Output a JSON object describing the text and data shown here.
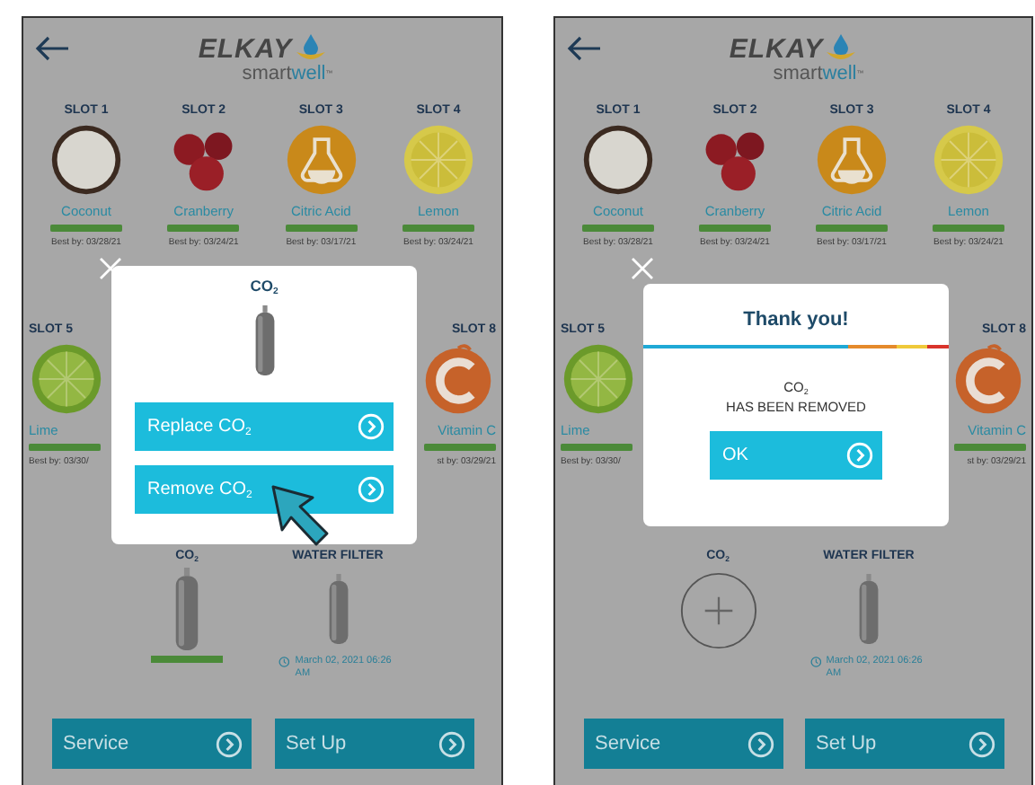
{
  "screens": [
    {
      "logo": {
        "brand": "ELKAY",
        "product": "smart",
        "product_accent": "well",
        "trademark": "™"
      },
      "slots": [
        {
          "label": "SLOT 1",
          "kind": "coconut",
          "name": "Coconut",
          "level": 1,
          "best_by": "Best by: 03/28/21"
        },
        {
          "label": "SLOT 2",
          "kind": "cranberry",
          "name": "Cranberry",
          "level": 1,
          "best_by": "Best by: 03/24/21"
        },
        {
          "label": "SLOT 3",
          "kind": "citric-acid",
          "name": "Citric Acid",
          "level": 1,
          "best_by": "Best by: 03/17/21"
        },
        {
          "label": "SLOT 4",
          "kind": "lemon",
          "name": "Lemon",
          "level": 1,
          "best_by": "Best by: 03/24/21"
        },
        {
          "label": "SLOT 5",
          "kind": "lime",
          "name": "Lime",
          "level": 1,
          "best_by": "Best by: 03/30/"
        },
        {
          "label": "SLOT 8",
          "kind": "vitamin-c",
          "name": "Vitamin C",
          "level": 1,
          "best_by": "st by: 03/29/21"
        }
      ],
      "co2": {
        "label": "CO$_{2}$",
        "installed": true,
        "level": 1
      },
      "water_filter": {
        "label": "WATER FILTER",
        "date": "March 02, 2021 06:26 AM"
      },
      "buttons": [
        "Service",
        "Set Up"
      ],
      "dialog": {
        "kind": "options",
        "title": "CO$_{2}$",
        "pointer": true,
        "buttons": [
          {
            "label": "Replace CO$_{2}$"
          },
          {
            "label": "Remove CO$_{2}$"
          }
        ]
      }
    },
    {
      "logo": {
        "brand": "ELKAY",
        "product": "smart",
        "product_accent": "well",
        "trademark": "™"
      },
      "slots": [
        {
          "label": "SLOT 1",
          "kind": "coconut",
          "name": "Coconut",
          "level": 1,
          "best_by": "Best by: 03/28/21"
        },
        {
          "label": "SLOT 2",
          "kind": "cranberry",
          "name": "Cranberry",
          "level": 1,
          "best_by": "Best by: 03/24/21"
        },
        {
          "label": "SLOT 3",
          "kind": "citric-acid",
          "name": "Citric Acid",
          "level": 1,
          "best_by": "Best by: 03/17/21"
        },
        {
          "label": "SLOT 4",
          "kind": "lemon",
          "name": "Lemon",
          "level": 1,
          "best_by": "Best by: 03/24/21"
        },
        {
          "label": "SLOT 5",
          "kind": "lime",
          "name": "Lime",
          "level": 1,
          "best_by": "Best by: 03/30/"
        },
        {
          "label": "SLOT 8",
          "kind": "vitamin-c",
          "name": "Vitamin C",
          "level": 1,
          "best_by": "st by: 03/29/21"
        }
      ],
      "co2": {
        "label": "CO$_{2}$",
        "installed": false
      },
      "water_filter": {
        "label": "WATER FILTER",
        "date": "March 02, 2021 06:26 AM"
      },
      "buttons": [
        "Service",
        "Set Up"
      ],
      "dialog": {
        "kind": "message",
        "title": "Thank you!",
        "message": [
          "CO$_{2}$",
          "HAS BEEN REMOVED"
        ],
        "buttons": [
          {
            "label": "OK"
          }
        ]
      }
    }
  ]
}
